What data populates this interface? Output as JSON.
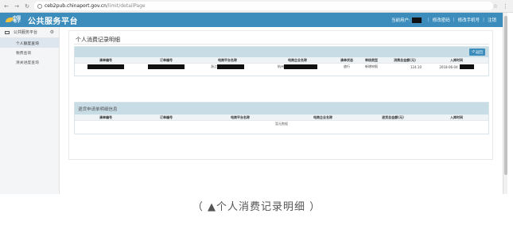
{
  "browser": {
    "host": "ceb2pub.chinaport.gov.cn",
    "path": "/limit/detailPage"
  },
  "header": {
    "app_title": "公共服务平台",
    "user_label": "当前用户:",
    "links": [
      "修改密码",
      "修改手机号",
      "注销"
    ]
  },
  "sidebar": {
    "section_label": "公共服务平台",
    "items": [
      {
        "label": "个人额度查询",
        "active": true
      },
      {
        "label": "税费查询",
        "active": false
      },
      {
        "label": "清关进度查询",
        "active": false
      }
    ]
  },
  "main": {
    "page_title": "个人消费记录明细",
    "back_button": "返回",
    "table1": {
      "columns": [
        "清单编号",
        "订单编号",
        "电商平台名称",
        "电商企业名称",
        "清单状态",
        "审核类型",
        "消费总金额(元)",
        "入库时间"
      ],
      "row": {
        "cell_0": "",
        "cell_1": "",
        "cell_2_prefix": "浙江",
        "cell_3_prefix": "杭州",
        "status": "放行",
        "review_type": "新增申报",
        "amount": "124.10",
        "time_prefix": "2018-06-04"
      }
    },
    "table2": {
      "title": "退货申请单明细信息",
      "columns": [
        "清单编号",
        "订单编号",
        "电商平台名称",
        "电商企业名称",
        "退货总金额(元)",
        "入库时间"
      ],
      "empty_text": "暂无数据"
    }
  },
  "caption": "（ ▲个人消费记录明细 ）"
}
